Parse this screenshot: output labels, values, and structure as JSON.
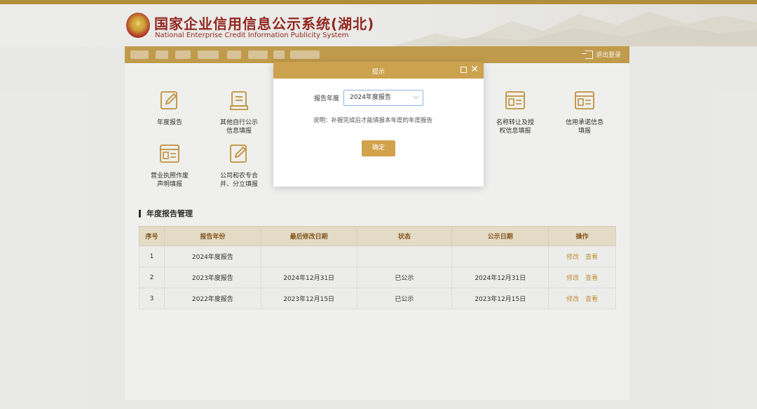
{
  "header": {
    "title": "国家企业信用信息公示系统(湖北)",
    "subtitle": "National Enterprise Credit Information Publicity System"
  },
  "navbar": {
    "logout_label": "退出登录"
  },
  "tiles": [
    {
      "label": "年度报告",
      "icon": "pencil-doc-icon"
    },
    {
      "label": "其他自行公示信息填报",
      "icon": "list-doc-icon"
    },
    {
      "label": "名称转让及授权信息填报",
      "icon": "card-doc-icon"
    },
    {
      "label": "信用承诺信息填报",
      "icon": "card-doc-icon"
    },
    {
      "label": "营业执照作废声明填报",
      "icon": "card-doc-icon"
    },
    {
      "label": "公司和农专合并、分立填报",
      "icon": "pencil-doc-icon"
    }
  ],
  "section": {
    "title": "年度报告管理"
  },
  "table": {
    "headers": [
      "序号",
      "报告年份",
      "最后修改日期",
      "状态",
      "公示日期",
      "操作"
    ],
    "rows": [
      {
        "index": "1",
        "year": "2024年度报告",
        "modified": "",
        "status": "",
        "published": "",
        "edit": "修改",
        "view": "查看"
      },
      {
        "index": "2",
        "year": "2023年度报告",
        "modified": "2024年12月31日",
        "status": "已公示",
        "published": "2024年12月31日",
        "edit": "修改",
        "view": "查看"
      },
      {
        "index": "3",
        "year": "2022年度报告",
        "modified": "2023年12月15日",
        "status": "已公示",
        "published": "2023年12月15日",
        "edit": "修改",
        "view": "查看"
      }
    ]
  },
  "dialog": {
    "title": "提示",
    "field_label": "报告年度",
    "selected": "2024年度报告",
    "note": "说明：补报完成后才能填报本年度的年度报告",
    "confirm": "确定"
  },
  "colors": {
    "accent": "#c9a24f",
    "title_red": "#9a2a22",
    "link": "#c8993e"
  }
}
